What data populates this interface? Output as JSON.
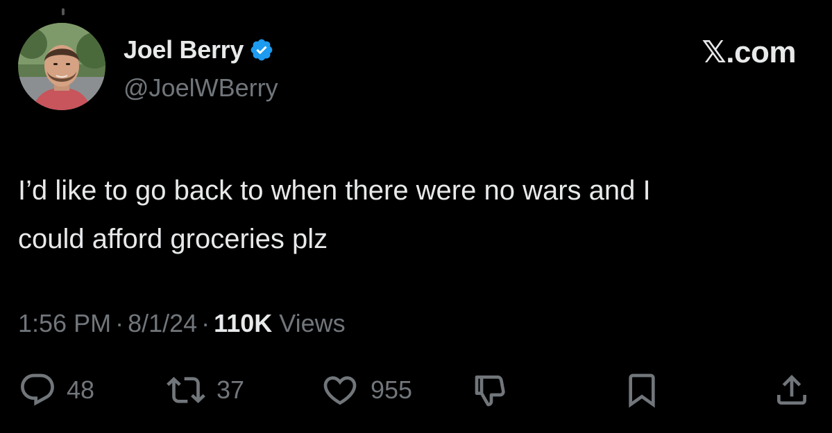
{
  "author": {
    "display_name": "Joel Berry",
    "handle": "@JoelWBerry",
    "verified": true,
    "verified_color": "#1d9bf0"
  },
  "brand": "𝕏.com",
  "tweet": {
    "text_line1": "I’d like to go back to when there were no wars and I",
    "text_line2": "could afford groceries plz"
  },
  "meta": {
    "time": "1:56 PM",
    "date": "8/1/24",
    "views_count": "110K",
    "views_label": "Views",
    "separator": "·"
  },
  "actions": {
    "replies": "48",
    "reposts": "37",
    "likes": "955"
  },
  "icons": {
    "reply": "reply-icon",
    "repost": "repost-icon",
    "like": "heart-icon",
    "downvote": "thumbs-down-icon",
    "bookmark": "bookmark-icon",
    "share": "share-icon"
  },
  "colors": {
    "background": "#000000",
    "text_primary": "#e7e9ea",
    "text_secondary": "#71767b"
  }
}
